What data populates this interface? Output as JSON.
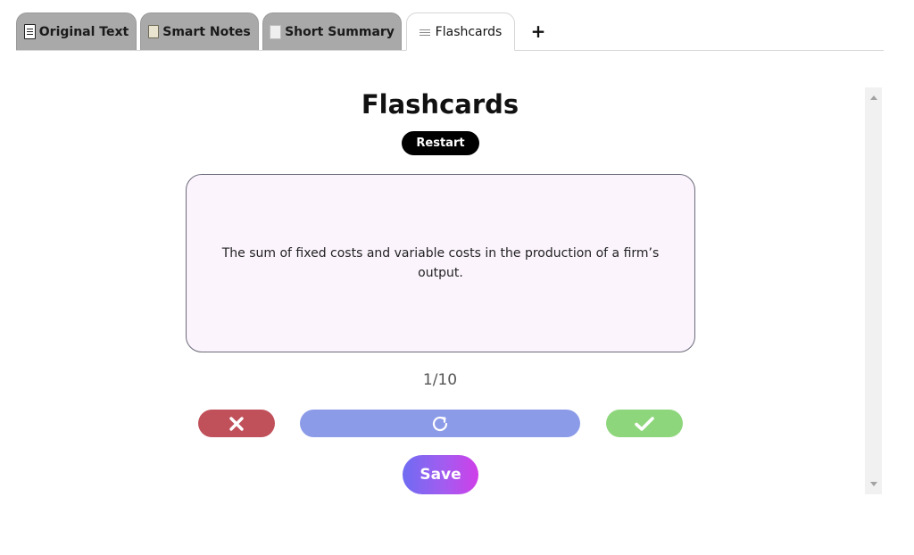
{
  "tabs": [
    {
      "label": "Original Text",
      "icon": "document-icon",
      "active": false
    },
    {
      "label": "Smart Notes",
      "icon": "note-icon",
      "active": false
    },
    {
      "label": "Short Summary",
      "icon": "page-icon",
      "active": false
    },
    {
      "label": "Flashcards",
      "icon": "cards-icon",
      "active": true
    }
  ],
  "add_tab_label": "+",
  "main": {
    "title": "Flashcards",
    "restart_label": "Restart",
    "card_text": "The sum of fixed costs and variable costs in the production of a firm’s output.",
    "counter": "1/10",
    "save_label": "Save"
  },
  "colors": {
    "wrong": "#c0505a",
    "flip": "#8c9be8",
    "correct": "#8ed67c",
    "card_background": "#fbf4fd",
    "save_gradient_start": "#6f6cf2",
    "save_gradient_end": "#cf3fe8"
  },
  "actions": {
    "wrong_icon": "close-icon",
    "flip_icon": "rotate-icon",
    "correct_icon": "check-icon"
  }
}
